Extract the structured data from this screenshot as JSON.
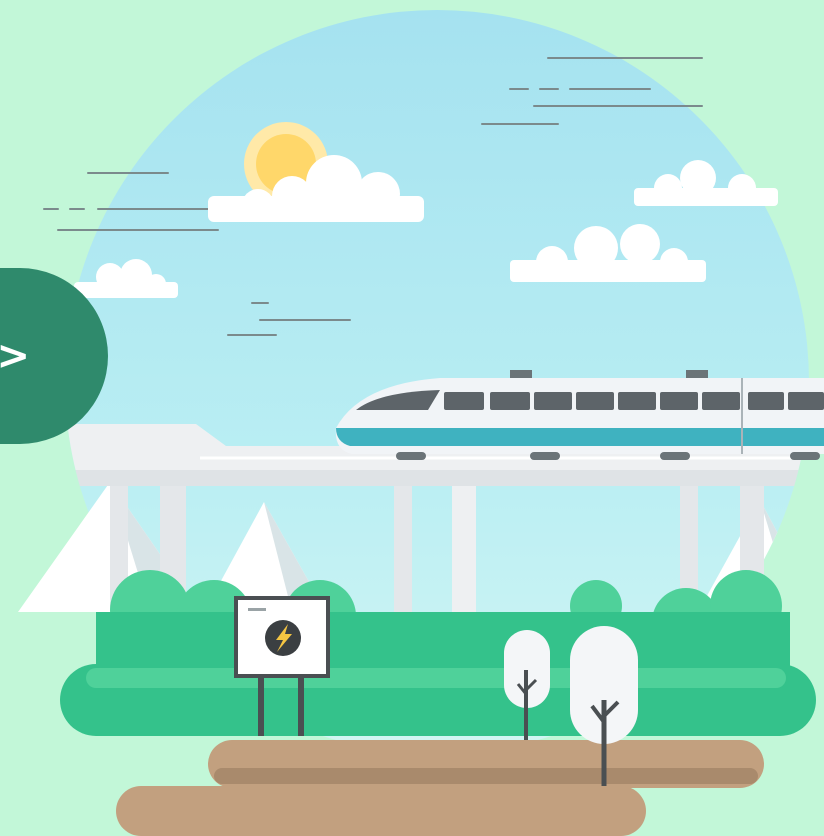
{
  "navigation": {
    "next_label": ">"
  },
  "illustration": {
    "subject": "high-speed-train-on-elevated-track",
    "sign_icon": "lightning-bolt-icon",
    "colors": {
      "background": "#c2f7d8",
      "sky_top": "#a8e4f0",
      "sky_bottom": "#c8f3f4",
      "sun": "#ffd76a",
      "sun_halo": "#ffe9a8",
      "cloud": "#ffffff",
      "train_body": "#f1f4f7",
      "train_stripe": "#3fb2c0",
      "train_window": "#5d6469",
      "bridge": "#eef0f2",
      "bush_light": "#4fd19a",
      "bush_dark": "#34c28b",
      "ground": "#c2a07f",
      "ground_shadow": "#a98a6c",
      "button": "#2f8a6c"
    }
  }
}
